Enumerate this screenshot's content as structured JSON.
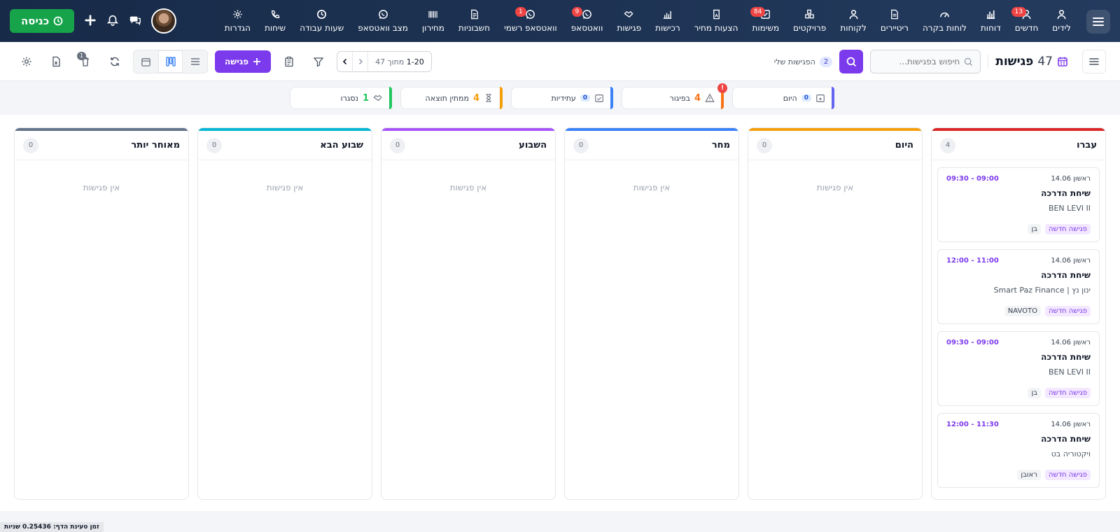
{
  "nav": {
    "items": [
      {
        "label": "לידים",
        "icon": "user-icon",
        "badge": ""
      },
      {
        "label": "חדשים",
        "icon": "users-icon",
        "badge": "13"
      },
      {
        "label": "דוחות",
        "icon": "bar-chart-icon",
        "badge": ""
      },
      {
        "label": "לוחות בקרה",
        "icon": "gauge-icon",
        "badge": ""
      },
      {
        "label": "ריטיירים",
        "icon": "document-icon",
        "badge": ""
      },
      {
        "label": "לקוחות",
        "icon": "user-icon",
        "badge": ""
      },
      {
        "label": "פרויקטים",
        "icon": "cubes-icon",
        "badge": ""
      },
      {
        "label": "משימות",
        "icon": "checkbox-icon",
        "badge": "84"
      },
      {
        "label": "הצעות מחיר",
        "icon": "quote-icon",
        "badge": ""
      },
      {
        "label": "רכישות",
        "icon": "purchase-icon",
        "badge": ""
      },
      {
        "label": "פגישות",
        "icon": "handshake-icon",
        "badge": ""
      },
      {
        "label": "וואטסאפ",
        "icon": "whatsapp-icon",
        "badge": "9"
      },
      {
        "label": "וואטסאפ רשמי",
        "icon": "whatsapp-icon",
        "badge": "1"
      },
      {
        "label": "חשבוניות",
        "icon": "invoice-icon",
        "badge": ""
      },
      {
        "label": "מחירון",
        "icon": "barcode-icon",
        "badge": ""
      },
      {
        "label": "מצב וואטסאפ",
        "icon": "whatsapp-icon",
        "badge": ""
      },
      {
        "label": "שעות עבודה",
        "icon": "clock-icon",
        "badge": ""
      },
      {
        "label": "שיחות",
        "icon": "phone-icon",
        "badge": ""
      },
      {
        "label": "הגדרות",
        "icon": "gear-icon",
        "badge": ""
      }
    ],
    "enter_button": "כניסה"
  },
  "toolbar": {
    "title": "פגישות",
    "count": "47",
    "search_placeholder": "חיפוש בפגישות...",
    "my_meetings_label": "הפגישות שלי",
    "my_meetings_count": "2",
    "add_button": "פגישה",
    "pager_range": "1-20",
    "pager_of": "מתוך 47",
    "trash_badge": "1"
  },
  "status_cards": [
    {
      "label": "היום",
      "num": "0",
      "color": "#6366f1",
      "alert": false
    },
    {
      "label": "בפיגור",
      "num": "4",
      "color": "#f97316",
      "alert": true
    },
    {
      "label": "עתידיות",
      "num": "0",
      "color": "#3b82f6",
      "alert": false
    },
    {
      "label": "ממתין תוצאה",
      "num": "4",
      "color": "#f59e0b",
      "alert": false
    },
    {
      "label": "נסגרו",
      "num": "1",
      "color": "#22c55e",
      "alert": false
    }
  ],
  "columns": [
    {
      "title": "עברו",
      "count": "4",
      "color": "#dc2626",
      "empty_text": "",
      "cards": [
        {
          "date": "ראשון 14.06",
          "time": "09:00 - 09:30",
          "title": "שיחת הדרכה",
          "client": "BEN LEVI II",
          "tag1": "פגישה חדשה",
          "tag2": "בן"
        },
        {
          "date": "ראשון 14.06",
          "time": "11:00 - 12:00",
          "title": "שיחת הדרכה",
          "client": "ינון נץ | Smart Paz Finance",
          "tag1": "פגישה חדשה",
          "tag2": "NAVOTO"
        },
        {
          "date": "ראשון 14.06",
          "time": "09:00 - 09:30",
          "title": "שיחת הדרכה",
          "client": "BEN LEVI II",
          "tag1": "פגישה חדשה",
          "tag2": "בן"
        },
        {
          "date": "ראשון 14.06",
          "time": "11:30 - 12:00",
          "title": "שיחת הדרכה",
          "client": "ויקטוריה בט",
          "tag1": "פגישה חדשה",
          "tag2": "ראובן"
        }
      ]
    },
    {
      "title": "היום",
      "count": "0",
      "color": "#f59e0b",
      "empty_text": "אין פגישות",
      "cards": []
    },
    {
      "title": "מחר",
      "count": "0",
      "color": "#3b82f6",
      "empty_text": "אין פגישות",
      "cards": []
    },
    {
      "title": "השבוע",
      "count": "0",
      "color": "#a855f7",
      "empty_text": "אין פגישות",
      "cards": []
    },
    {
      "title": "שבוע הבא",
      "count": "0",
      "color": "#06b6d4",
      "empty_text": "אין פגישות",
      "cards": []
    },
    {
      "title": "מאוחר יותר",
      "count": "0",
      "color": "#64748b",
      "empty_text": "אין פגישות",
      "cards": []
    }
  ],
  "footer": "זמן טעינת הדף: 0.25436 שניות"
}
